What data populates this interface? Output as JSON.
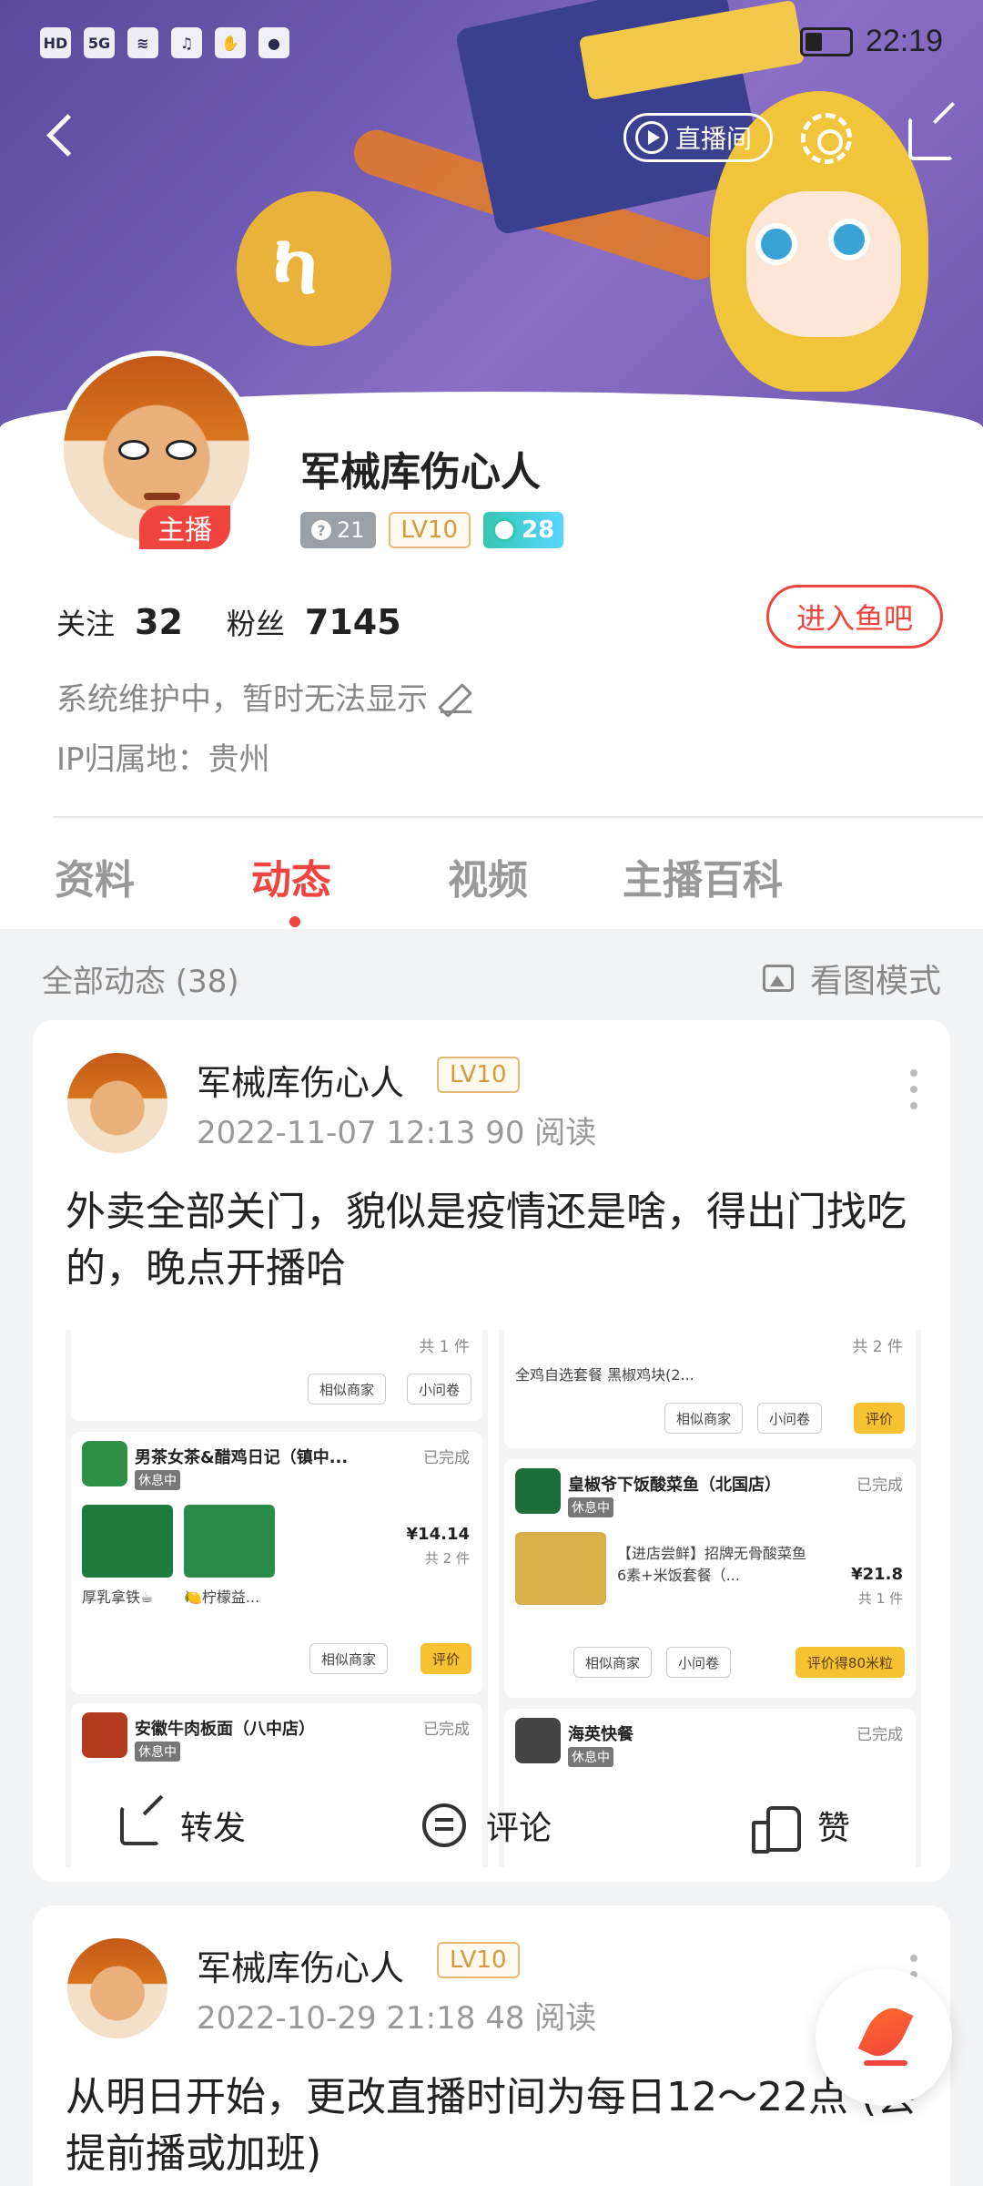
{
  "status_bar": {
    "left_icons": [
      "HD",
      "5G",
      "signal-icon",
      "wifi-icon",
      "music-icon",
      "hand-icon",
      "chat-icon"
    ],
    "time": "22:19"
  },
  "header": {
    "live_room_label": "直播间"
  },
  "profile": {
    "anchor_badge": "主播",
    "username": "军械库伤心人",
    "badge_question_count": "21",
    "level": "LV10",
    "fish_badge": "28",
    "following_label": "关注",
    "following_count": "32",
    "fans_label": "粉丝",
    "fans_count": "7145",
    "enter_bar_label": "进入鱼吧",
    "bio": "系统维护中，暂时无法显示",
    "ip_location": "IP归属地：贵州"
  },
  "tabs": [
    {
      "label": "资料",
      "active": false
    },
    {
      "label": "动态",
      "active": true
    },
    {
      "label": "视频",
      "active": false
    },
    {
      "label": "主播百科",
      "active": false
    }
  ],
  "feed": {
    "title": "全部动态 (38)",
    "view_mode_label": "看图模式"
  },
  "posts": [
    {
      "author": "军械库伤心人",
      "level": "LV10",
      "meta": "2022-11-07  12:13   90 阅读",
      "text": "外卖全部关门，貌似是疫情还是啥，得出门找吃的，晚点开播哈",
      "screenshot": {
        "left": {
          "top_count": "共 1 件",
          "order1": {
            "shop": "男茶女茶&醋鸡日记（镇中...",
            "status": "已完成",
            "rest": "休息中",
            "item1": "厚乳拿铁☕",
            "item2": "🍋柠檬益...",
            "price": "¥14.14",
            "count": "共 2 件"
          },
          "order2": {
            "shop": "安徽牛肉板面（八中店）",
            "status": "已完成",
            "rest": "休息中"
          }
        },
        "right": {
          "top_count": "共 2 件",
          "top_items": "全鸡自选套餐  黑椒鸡块(2...",
          "order1": {
            "shop": "皇椒爷下饭酸菜鱼（北国店）",
            "status": "已完成",
            "rest": "休息中",
            "item": "【进店尝鲜】招牌无骨酸菜鱼6素+米饭套餐（...",
            "price": "¥21.8",
            "count": "共 1 件",
            "rate_reward": "评价得80米粒"
          },
          "order2": {
            "shop": "海英快餐",
            "status": "已完成",
            "rest": "休息中"
          }
        },
        "buttons": {
          "similar": "相似商家",
          "coupon": "小问卷",
          "rate": "评价"
        }
      },
      "actions": {
        "share": "转发",
        "comment": "评论",
        "like": "赞"
      }
    },
    {
      "author": "军械库伤心人",
      "level": "LV10",
      "meta": "2022-10-29  21:18   48 阅读",
      "text": "从明日开始，更改直播时间为每日12～22点 (会提前播或加班)"
    }
  ]
}
